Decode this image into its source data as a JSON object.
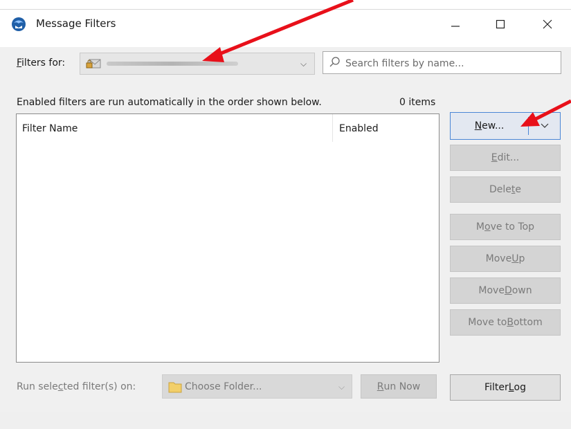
{
  "window": {
    "title": "Message Filters",
    "controls": {
      "minimize": "—",
      "maximize": "☐",
      "close": "✕"
    }
  },
  "filters_for": {
    "label_pre": "",
    "label_mnemonic": "F",
    "label_post": "ilters for:",
    "account_icon": "account-icon",
    "chevron": "⌵"
  },
  "search": {
    "placeholder": "Search filters by name...",
    "value": "",
    "icon": "search-icon"
  },
  "info": {
    "text": "Enabled filters are run automatically in the order shown below.",
    "count": "0 items"
  },
  "list": {
    "columns": {
      "name": "Filter Name",
      "enabled": "Enabled"
    },
    "rows": []
  },
  "buttons": {
    "new": {
      "pre": "",
      "mn": "N",
      "post": "ew..."
    },
    "edit": {
      "pre": "",
      "mn": "E",
      "post": "dit..."
    },
    "delete": {
      "pre": "Dele",
      "mn": "t",
      "post": "e"
    },
    "move_top": {
      "pre": "M",
      "mn": "o",
      "post": "ve to Top"
    },
    "move_up": {
      "pre": "Move ",
      "mn": "U",
      "post": "p"
    },
    "move_down": {
      "pre": "Move ",
      "mn": "D",
      "post": "own"
    },
    "move_bottom": {
      "pre": "Move to ",
      "mn": "B",
      "post": "ottom"
    }
  },
  "bottom": {
    "run_label_pre": "Run sele",
    "run_label_mn": "c",
    "run_label_post": "ted filter(s) on:",
    "folder_placeholder": "Choose Folder...",
    "folder_chevron": "⌵",
    "run_now": {
      "pre": "",
      "mn": "R",
      "post": "un Now"
    },
    "filter_log": {
      "pre": "Filter ",
      "mn": "L",
      "post": "og"
    }
  },
  "colors": {
    "arrow": "#e8101a",
    "focus_border": "#4a86d6",
    "disabled_text": "#7a7a7a"
  }
}
